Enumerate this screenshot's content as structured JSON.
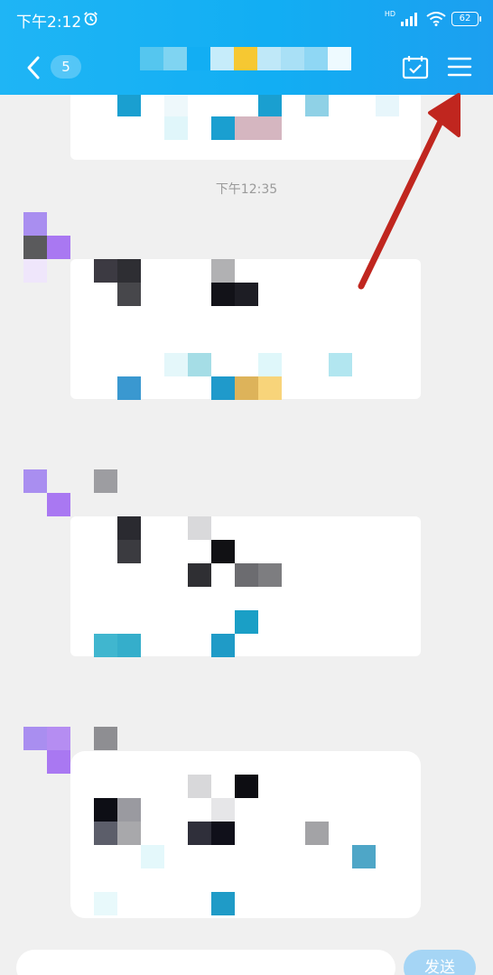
{
  "status_bar": {
    "time": "下午2:12",
    "network": "HD",
    "battery": "62"
  },
  "header": {
    "unread_count": "5"
  },
  "messages": {
    "timestamp": "下午12:35"
  },
  "input_bar": {
    "send_label": "发送"
  },
  "colors": {
    "accent": "#12aef3",
    "arrow": "#c0261f"
  }
}
